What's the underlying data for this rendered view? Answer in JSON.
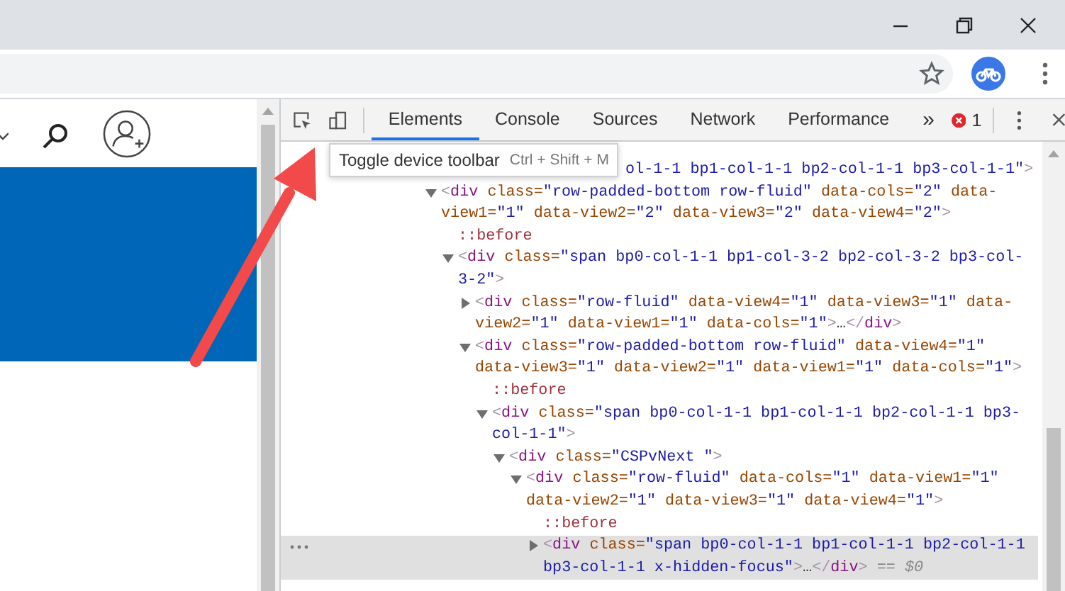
{
  "devtools": {
    "tabs": [
      {
        "label": "Elements",
        "selected": true
      },
      {
        "label": "Console",
        "selected": false
      },
      {
        "label": "Sources",
        "selected": false
      },
      {
        "label": "Network",
        "selected": false
      },
      {
        "label": "Performance",
        "selected": false
      }
    ],
    "overflow_label": "»",
    "error_count": "1",
    "tooltip": {
      "label": "Toggle device toolbar",
      "shortcut": "Ctrl + Shift + M"
    },
    "clipped_line": {
      "tokens": [
        {
          "kind": "value",
          "s": "ol-1-1 bp1-col-1-1 bp2-col-1-1 bp3-col-1-1\""
        },
        {
          "kind": "bracket",
          "s": ">"
        }
      ]
    },
    "tree": [
      {
        "kind": "element",
        "expanded": true,
        "selected": false,
        "tokens": [
          {
            "kind": "bracket",
            "s": "<"
          },
          {
            "kind": "tag",
            "s": "div"
          },
          {
            "kind": "attr",
            "s": " class="
          },
          {
            "kind": "value",
            "s": "\"row-padded-bottom row-fluid\""
          },
          {
            "kind": "attr",
            "s": " data-cols="
          },
          {
            "kind": "value",
            "s": "\"2\""
          },
          {
            "kind": "attr",
            "s": " data-view1="
          },
          {
            "kind": "value",
            "s": "\"1\""
          },
          {
            "kind": "attr",
            "s": " data-view2="
          },
          {
            "kind": "value",
            "s": "\"2\""
          },
          {
            "kind": "attr",
            "s": " data-view3="
          },
          {
            "kind": "value",
            "s": "\"2\""
          },
          {
            "kind": "attr",
            "s": " data-view4="
          },
          {
            "kind": "value",
            "s": "\"2\""
          },
          {
            "kind": "bracket",
            "s": ">"
          }
        ],
        "children": [
          {
            "kind": "pseudo",
            "selected": false,
            "tokens": [
              {
                "kind": "pseudo",
                "s": "::before"
              }
            ]
          },
          {
            "kind": "element",
            "expanded": true,
            "selected": false,
            "tokens": [
              {
                "kind": "bracket",
                "s": "<"
              },
              {
                "kind": "tag",
                "s": "div"
              },
              {
                "kind": "attr",
                "s": " class="
              },
              {
                "kind": "value",
                "s": "\"span bp0-col-1-1 bp1-col-3-2 bp2-col-3-2 bp3-col-3-2\""
              },
              {
                "kind": "bracket",
                "s": ">"
              }
            ],
            "children": [
              {
                "kind": "element",
                "expanded": false,
                "selected": false,
                "tokens": [
                  {
                    "kind": "bracket",
                    "s": "<"
                  },
                  {
                    "kind": "tag",
                    "s": "div"
                  },
                  {
                    "kind": "attr",
                    "s": " class="
                  },
                  {
                    "kind": "value",
                    "s": "\"row-fluid\""
                  },
                  {
                    "kind": "attr",
                    "s": " data-view4="
                  },
                  {
                    "kind": "value",
                    "s": "\"1\""
                  },
                  {
                    "kind": "attr",
                    "s": " data-view3="
                  },
                  {
                    "kind": "value",
                    "s": "\"1\""
                  },
                  {
                    "kind": "attr",
                    "s": " data-view2="
                  },
                  {
                    "kind": "value",
                    "s": "\"1\""
                  },
                  {
                    "kind": "attr",
                    "s": " data-view1="
                  },
                  {
                    "kind": "value",
                    "s": "\"1\""
                  },
                  {
                    "kind": "attr",
                    "s": " data-cols="
                  },
                  {
                    "kind": "value",
                    "s": "\"1\""
                  },
                  {
                    "kind": "bracket",
                    "s": ">"
                  },
                  {
                    "kind": "text",
                    "s": "…"
                  },
                  {
                    "kind": "bracket",
                    "s": "</"
                  },
                  {
                    "kind": "tag",
                    "s": "div"
                  },
                  {
                    "kind": "bracket",
                    "s": ">"
                  }
                ]
              },
              {
                "kind": "element",
                "expanded": true,
                "selected": false,
                "tokens": [
                  {
                    "kind": "bracket",
                    "s": "<"
                  },
                  {
                    "kind": "tag",
                    "s": "div"
                  },
                  {
                    "kind": "attr",
                    "s": " class="
                  },
                  {
                    "kind": "value",
                    "s": "\"row-padded-bottom row-fluid\""
                  },
                  {
                    "kind": "attr",
                    "s": " data-view4="
                  },
                  {
                    "kind": "value",
                    "s": "\"1\""
                  },
                  {
                    "kind": "attr",
                    "s": " data-view3="
                  },
                  {
                    "kind": "value",
                    "s": "\"1\""
                  },
                  {
                    "kind": "attr",
                    "s": " data-view2="
                  },
                  {
                    "kind": "value",
                    "s": "\"1\""
                  },
                  {
                    "kind": "attr",
                    "s": " data-view1="
                  },
                  {
                    "kind": "value",
                    "s": "\"1\""
                  },
                  {
                    "kind": "attr",
                    "s": " data-cols="
                  },
                  {
                    "kind": "value",
                    "s": "\"1\""
                  },
                  {
                    "kind": "bracket",
                    "s": ">"
                  }
                ],
                "children": [
                  {
                    "kind": "pseudo",
                    "selected": false,
                    "tokens": [
                      {
                        "kind": "pseudo",
                        "s": "::before"
                      }
                    ]
                  },
                  {
                    "kind": "element",
                    "expanded": true,
                    "selected": false,
                    "tokens": [
                      {
                        "kind": "bracket",
                        "s": "<"
                      },
                      {
                        "kind": "tag",
                        "s": "div"
                      },
                      {
                        "kind": "attr",
                        "s": " class="
                      },
                      {
                        "kind": "value",
                        "s": "\"span bp0-col-1-1 bp1-col-1-1 bp2-col-1-1 bp3-col-1-1\""
                      },
                      {
                        "kind": "bracket",
                        "s": ">"
                      }
                    ],
                    "children": [
                      {
                        "kind": "element",
                        "expanded": true,
                        "selected": false,
                        "tokens": [
                          {
                            "kind": "bracket",
                            "s": "<"
                          },
                          {
                            "kind": "tag",
                            "s": "div"
                          },
                          {
                            "kind": "attr",
                            "s": " class="
                          },
                          {
                            "kind": "value",
                            "s": "\"CSPvNext \""
                          },
                          {
                            "kind": "bracket",
                            "s": ">"
                          }
                        ],
                        "children": [
                          {
                            "kind": "element",
                            "expanded": true,
                            "selected": false,
                            "tokens": [
                              {
                                "kind": "bracket",
                                "s": "<"
                              },
                              {
                                "kind": "tag",
                                "s": "div"
                              },
                              {
                                "kind": "attr",
                                "s": " class="
                              },
                              {
                                "kind": "value",
                                "s": "\"row-fluid\""
                              },
                              {
                                "kind": "attr",
                                "s": " data-cols="
                              },
                              {
                                "kind": "value",
                                "s": "\"1\""
                              },
                              {
                                "kind": "attr",
                                "s": " data-view1="
                              },
                              {
                                "kind": "value",
                                "s": "\"1\""
                              },
                              {
                                "kind": "attr",
                                "s": " data-view2="
                              },
                              {
                                "kind": "value",
                                "s": "\"1\""
                              },
                              {
                                "kind": "attr",
                                "s": " data-view3="
                              },
                              {
                                "kind": "value",
                                "s": "\"1\""
                              },
                              {
                                "kind": "attr",
                                "s": " data-view4="
                              },
                              {
                                "kind": "value",
                                "s": "\"1\""
                              },
                              {
                                "kind": "bracket",
                                "s": ">"
                              }
                            ],
                            "children": [
                              {
                                "kind": "pseudo",
                                "selected": false,
                                "tokens": [
                                  {
                                    "kind": "pseudo",
                                    "s": "::before"
                                  }
                                ]
                              },
                              {
                                "kind": "element",
                                "expanded": false,
                                "selected": true,
                                "tokens": [
                                  {
                                    "kind": "bracket",
                                    "s": "<"
                                  },
                                  {
                                    "kind": "tag",
                                    "s": "div"
                                  },
                                  {
                                    "kind": "attr",
                                    "s": " class="
                                  },
                                  {
                                    "kind": "value",
                                    "s": "\"span bp0-col-1-1 bp1-col-1-1 bp2-col-1-1 bp3-col-1-1 x-hidden-focus\""
                                  },
                                  {
                                    "kind": "bracket",
                                    "s": ">"
                                  },
                                  {
                                    "kind": "text",
                                    "s": "…"
                                  },
                                  {
                                    "kind": "bracket",
                                    "s": "</"
                                  },
                                  {
                                    "kind": "tag",
                                    "s": "div"
                                  },
                                  {
                                    "kind": "bracket",
                                    "s": ">"
                                  },
                                  {
                                    "kind": "ref",
                                    "s": " == $0"
                                  }
                                ]
                              }
                            ]
                          }
                        ]
                      }
                    ]
                  }
                ]
              }
            ]
          }
        ]
      }
    ]
  }
}
